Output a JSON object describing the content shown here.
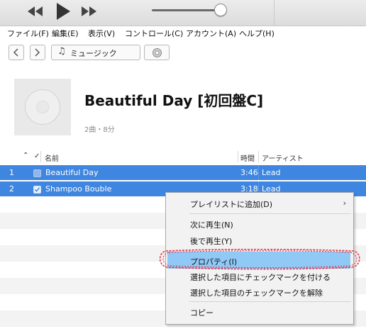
{
  "menubar": {
    "items": [
      "ファイル(F)",
      "編集(E)",
      "表示(V)",
      "コントロール(C)",
      "アカウント(A)",
      "ヘルプ(H)"
    ]
  },
  "navbar": {
    "library_label": "ミュージック"
  },
  "album": {
    "title": "Beautiful Day [初回盤C]",
    "meta": "2曲・8分"
  },
  "table": {
    "headers": {
      "name": "名前",
      "time": "時間",
      "artist": "アーティスト",
      "check": "✓"
    },
    "rows": [
      {
        "num": "1",
        "name": "Beautiful Day",
        "time": "3:46",
        "artist": "Lead",
        "checked": false
      },
      {
        "num": "2",
        "name": "Shampoo Bouble",
        "time": "3:18",
        "artist": "Lead",
        "checked": true
      }
    ]
  },
  "context_menu": {
    "add_to_playlist": "プレイリストに追加(D)",
    "play_next": "次に再生(N)",
    "play_later": "後で再生(Y)",
    "properties": "プロパティ(I)",
    "check_selected": "選択した項目にチェックマークを付ける",
    "uncheck_selected": "選択した項目のチェックマークを解除",
    "copy": "コピー"
  },
  "colors": {
    "selection": "#3f86e0",
    "menu_highlight": "#90c8f6",
    "annotation": "#e03a4a"
  },
  "volume_level": 0.92
}
